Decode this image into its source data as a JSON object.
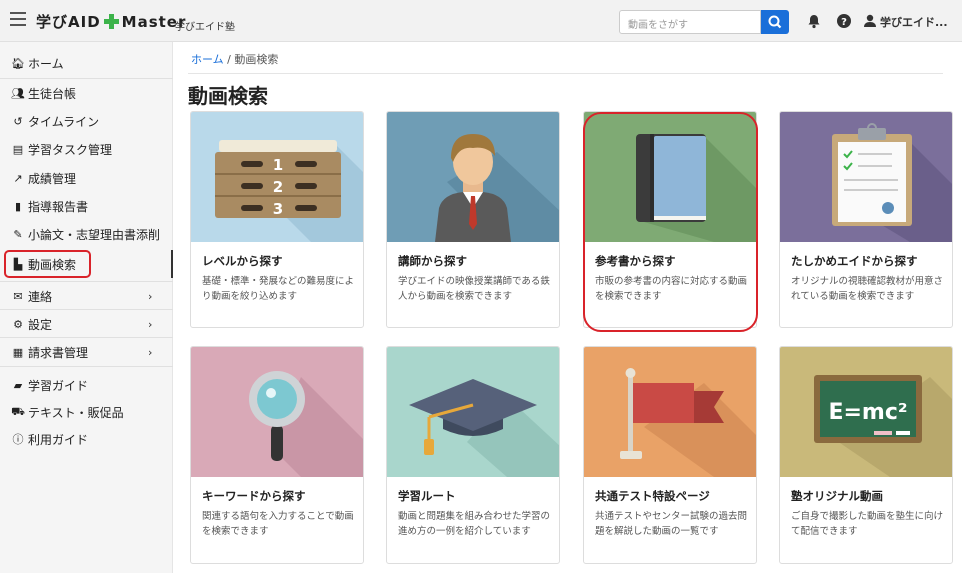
{
  "brand": {
    "name": "学びAID",
    "suffix": "Master",
    "sub": "学びエイド塾"
  },
  "search": {
    "placeholder": "動画をさがす"
  },
  "user": {
    "name": "学びエイド..."
  },
  "sidebar": {
    "items": [
      {
        "label": "ホーム",
        "icon": "home-icon"
      },
      {
        "label": "生徒台帳",
        "icon": "users-icon"
      },
      {
        "label": "タイムライン",
        "icon": "history-icon"
      },
      {
        "label": "学習タスク管理",
        "icon": "clipboard-icon"
      },
      {
        "label": "成績管理",
        "icon": "chart-icon"
      },
      {
        "label": "指導報告書",
        "icon": "file-icon"
      },
      {
        "label": "小論文・志望理由書添削",
        "icon": "pen-icon"
      },
      {
        "label": "動画検索",
        "icon": "video-icon"
      },
      {
        "label": "連絡",
        "icon": "message-icon"
      },
      {
        "label": "設定",
        "icon": "user-cog-icon"
      },
      {
        "label": "請求書管理",
        "icon": "invoice-icon"
      },
      {
        "label": "学習ガイド",
        "icon": "book-open-icon"
      },
      {
        "label": "テキスト・販促品",
        "icon": "cart-icon"
      },
      {
        "label": "利用ガイド",
        "icon": "info-icon"
      }
    ]
  },
  "breadcrumb": {
    "home": "ホーム",
    "sep": "/",
    "current": "動画検索"
  },
  "page_title": "動画検索",
  "cards": [
    {
      "title": "レベルから探す",
      "desc": "基礎・標準・発展などの難易度により動画を絞り込めます",
      "icon": "level-steps-icon",
      "bg": "#b9d9ea"
    },
    {
      "title": "講師から探す",
      "desc": "学びエイドの映像授業講師である鉄人から動画を検索できます",
      "icon": "teacher-icon",
      "bg": "#6f9db5"
    },
    {
      "title": "参考書から探す",
      "desc": "市販の参考書の内容に対応する動画を検索できます",
      "icon": "book-icon",
      "bg": "#7faa74"
    },
    {
      "title": "たしかめエイドから探す",
      "desc": "オリジナルの視聴確認教材が用意されている動画を検索できます",
      "icon": "clipboard-check-icon",
      "bg": "#7b6f9b"
    },
    {
      "title": "キーワードから探す",
      "desc": "関連する語句を入力することで動画を検索できます",
      "icon": "magnifier-icon",
      "bg": "#d9a9b7"
    },
    {
      "title": "学習ルート",
      "desc": "動画と問題集を組み合わせた学習の進め方の一例を紹介しています",
      "icon": "graduation-cap-icon",
      "bg": "#a9d6cc"
    },
    {
      "title": "共通テスト特設ページ",
      "desc": "共通テストやセンター試験の過去問題を解説した動画の一覧です",
      "icon": "flag-icon",
      "bg": "#e9a267"
    },
    {
      "title": "塾オリジナル動画",
      "desc": "ご自身で撮影した動画を塾生に向けて配信できます",
      "icon": "blackboard-icon",
      "bg": "#c9b97a"
    }
  ],
  "blackboard_text": "E=mc²",
  "colors": {
    "accent": "#1a6fd9",
    "highlight": "#d9232a",
    "brand_green": "#3cb34a"
  }
}
